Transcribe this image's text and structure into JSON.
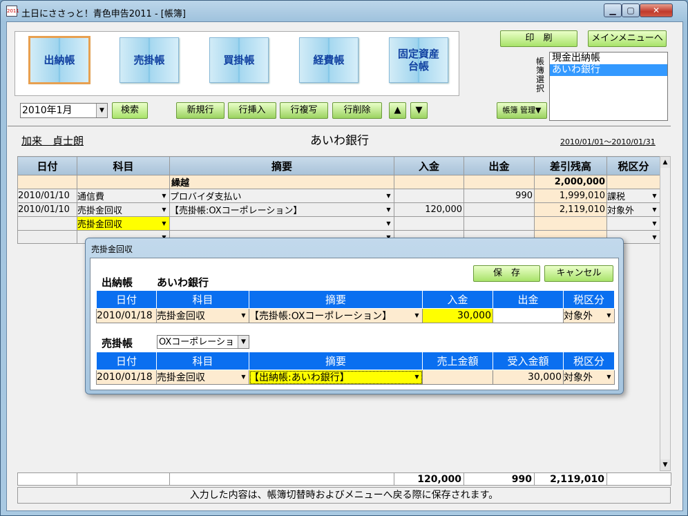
{
  "window": {
    "title": "土日にささっと！青色申告2011 - [帳簿]",
    "app_icon": "2011"
  },
  "books": [
    "出納帳",
    "売掛帳",
    "買掛帳",
    "経費帳",
    "固定資産台帳"
  ],
  "header": {
    "print_label": "印　刷",
    "menu_label": "メインメニューへ",
    "book_select_label": "帳簿選択",
    "book_list": [
      "現金出納帳",
      "あいわ銀行"
    ],
    "book_list_selected": 1
  },
  "toolbar": {
    "month": "2010年1月",
    "search": "検索",
    "new_row": "新規行",
    "insert_row": "行挿入",
    "copy_row": "行複写",
    "delete_row": "行削除",
    "up": "▲",
    "down": "▼",
    "book_manage": "帳簿 管理▼"
  },
  "ledger": {
    "user_name": "加来　貞士朗",
    "book_name": "あいわ銀行",
    "period": "2010/01/01～2010/01/31",
    "columns": [
      "日付",
      "科目",
      "摘要",
      "入金",
      "出金",
      "差引残高",
      "税区分"
    ],
    "carry_label": "繰越",
    "carry_balance": "2,000,000",
    "rows": [
      {
        "date": "2010/01/10",
        "account": "通信費",
        "memo": "プロバイダ支払い",
        "in": "",
        "out": "990",
        "balance": "1,999,010",
        "tax": "課税"
      },
      {
        "date": "2010/01/10",
        "account": "売掛金回収",
        "memo": "【売掛帳:OXコーポレーション】",
        "in": "120,000",
        "out": "",
        "balance": "2,119,010",
        "tax": "対象外"
      },
      {
        "date": "",
        "account": "売掛金回収",
        "memo": "",
        "in": "",
        "out": "",
        "balance": "",
        "tax": ""
      }
    ],
    "totals": {
      "in": "120,000",
      "out": "990",
      "balance": "2,119,010"
    },
    "status": "入力した内容は、帳簿切替時およびメニューへ戻る際に保存されます。"
  },
  "dialog": {
    "title": "売掛金回収",
    "save": "保　存",
    "cancel": "キャンセル",
    "section1_label": "出納帳",
    "section1_book": "あいわ銀行",
    "grid1_columns": [
      "日付",
      "科目",
      "摘要",
      "入金",
      "出金",
      "税区分"
    ],
    "grid1_row": {
      "date": "2010/01/18",
      "account": "売掛金回収",
      "memo": "【売掛帳:OXコーポレーション】",
      "in": "30,000",
      "out": "",
      "tax": "対象外"
    },
    "section2_label": "売掛帳",
    "section2_customer": "OXコーポレーショ",
    "grid2_columns": [
      "日付",
      "科目",
      "摘要",
      "売上金額",
      "受入金額",
      "税区分"
    ],
    "grid2_row": {
      "date": "2010/01/18",
      "account": "売掛金回収",
      "memo": "【出納帳:あいわ銀行】",
      "sales": "",
      "received": "30,000",
      "tax": "対象外"
    }
  }
}
